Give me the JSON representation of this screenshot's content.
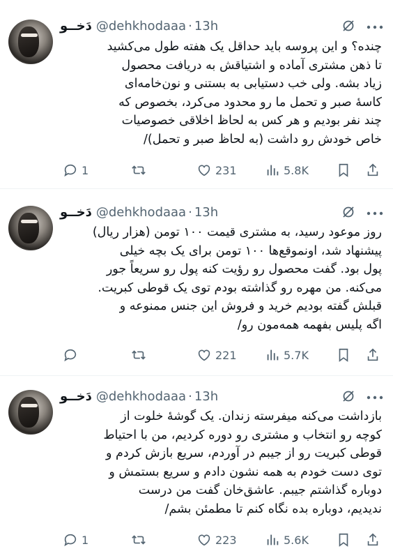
{
  "tweets": [
    {
      "name": "دَخــو",
      "handle": "@dehkhodaaa",
      "time": "13h",
      "lines": [
        "چنده؟ و این پروسه باید حداقل یک هفته طول می‌کشید",
        "تا ذهن مشتری آماده و اشتیاقش به دریافت محصول",
        "زیاد بشه. ولی خب دستیابی به بستنی و نون‌خامه‌ای",
        "کاسهٔ صبر و تحمل ما رو محدود می‌کرد، بخصوص که",
        "چند نفر بودیم و هر کس به لحاظ اخلاقی خصوصیات",
        "خاص خودش رو داشت (به لحاظ صبر و تحمل)/"
      ],
      "replies": "1",
      "retweets": "",
      "likes": "231",
      "views": "5.8K"
    },
    {
      "name": "دَخــو",
      "handle": "@dehkhodaaa",
      "time": "13h",
      "lines": [
        "روز موعود رسید، به مشتری قیمت ۱۰۰ تومن (هزار ریال)",
        "پیشنهاد شد، اونموقع‌ها ۱۰۰ تومن برای یک بچه خیلی",
        "پول بود. گفت محصول رو رؤیت کنه پول رو سریعاً جور",
        "می‌کنه. من مهره رو گذاشته بودم توی یک قوطی کبریت.",
        "قبلش گفته بودیم خرید و فروش این جنس ممنوعه و",
        "اگه پلیس بفهمه همه‌مون رو/"
      ],
      "replies": "",
      "retweets": "",
      "likes": "221",
      "views": "5.7K"
    },
    {
      "name": "دَخــو",
      "handle": "@dehkhodaaa",
      "time": "13h",
      "lines": [
        "بازداشت می‌کنه میفرسته زندان. یک گوشهٔ خلوت از",
        "کوچه رو انتخاب و مشتری رو دوره کردیم، من با احتیاط",
        "قوطی کبریت رو از جیبم در آوردم، سریع بازش کردم و",
        "توی دست خودم به همه نشون دادم و سریع بستمش و",
        "دوباره گذاشتم جیبم. عاشق‌خان گفت من درست",
        "ندیدیم، دوباره بده نگاه کنم تا مطمئن بشم/"
      ],
      "replies": "1",
      "retweets": "",
      "likes": "223",
      "views": "5.6K"
    }
  ],
  "icons": {
    "grok": "grok-icon",
    "more": "more-icon",
    "reply": "reply-icon",
    "retweet": "retweet-icon",
    "like": "heart-icon",
    "views": "views-icon",
    "bookmark": "bookmark-icon",
    "share": "share-icon"
  },
  "colors": {
    "text": "#0f1419",
    "secondary": "#536471",
    "divider": "#eff3f4"
  }
}
